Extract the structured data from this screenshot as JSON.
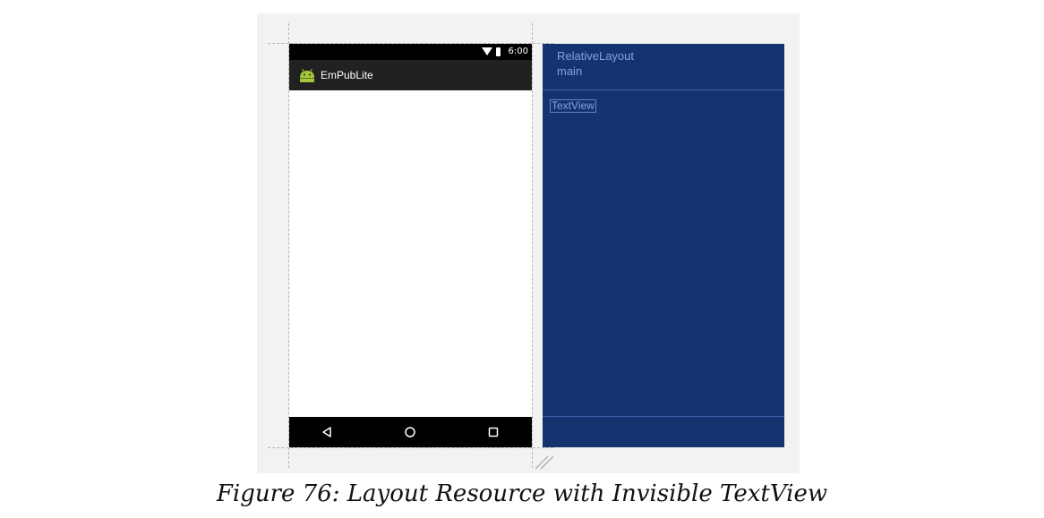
{
  "phone": {
    "status_time": "6:00",
    "app_title": "EmPubLite",
    "app_icon": "android-icon",
    "nav_icons": [
      "back-icon",
      "home-icon",
      "recents-icon"
    ]
  },
  "blueprint": {
    "layout_type": "RelativeLayout",
    "layout_name": "main",
    "textview_label": "TextView"
  },
  "caption": "Figure 76: Layout Resource with Invisible TextView",
  "colors": {
    "blueprint_bg": "#15346f",
    "blueprint_text": "#7da3e3",
    "app_bar": "#212121",
    "android_green": "#a4c639"
  }
}
